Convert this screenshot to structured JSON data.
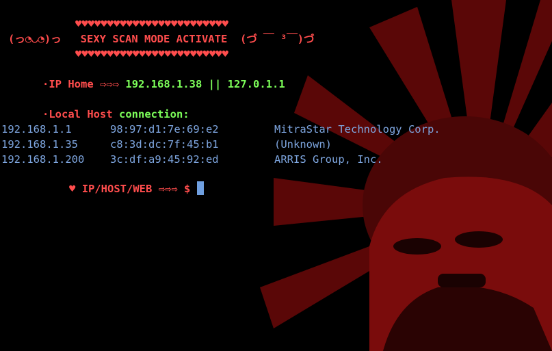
{
  "banner": {
    "hearts_line": "♥♥♥♥♥♥♥♥♥♥♥♥♥♥♥♥♥♥♥♥♥♥♥♥",
    "left_emoticon": "(っ◔◡◔)っ",
    "title": "SEXY SCAN MODE ACTIVATE",
    "right_emoticon": "(づ ￣ ³￣)づ"
  },
  "ip_home": {
    "bullet": "·",
    "label": "IP Home",
    "arrows": "⇨⇨⇨",
    "value": "192.168.1.38 || 127.0.1.1"
  },
  "local_host": {
    "bullet": "·",
    "label": "Local Host",
    "suffix": "connection:"
  },
  "hosts": [
    {
      "ip": "192.168.1.1",
      "mac": "98:97:d1:7e:69:e2",
      "vendor": "MitraStar Technology Corp."
    },
    {
      "ip": "192.168.1.35",
      "mac": "c8:3d:dc:7f:45:b1",
      "vendor": "(Unknown)"
    },
    {
      "ip": "192.168.1.200",
      "mac": "3c:df:a9:45:92:ed",
      "vendor": "ARRIS Group, Inc."
    }
  ],
  "prompt": {
    "heart": "♥",
    "label": "IP/HOST/WEB",
    "arrows": "⇨⇨⇨",
    "symbol": "$"
  },
  "colors": {
    "background": "#000000",
    "prompt_red": "#ff4d4d",
    "value_green": "#7dff5a",
    "table_blue": "#7ea6e0",
    "wallpaper_red": "#6e0a0a"
  }
}
